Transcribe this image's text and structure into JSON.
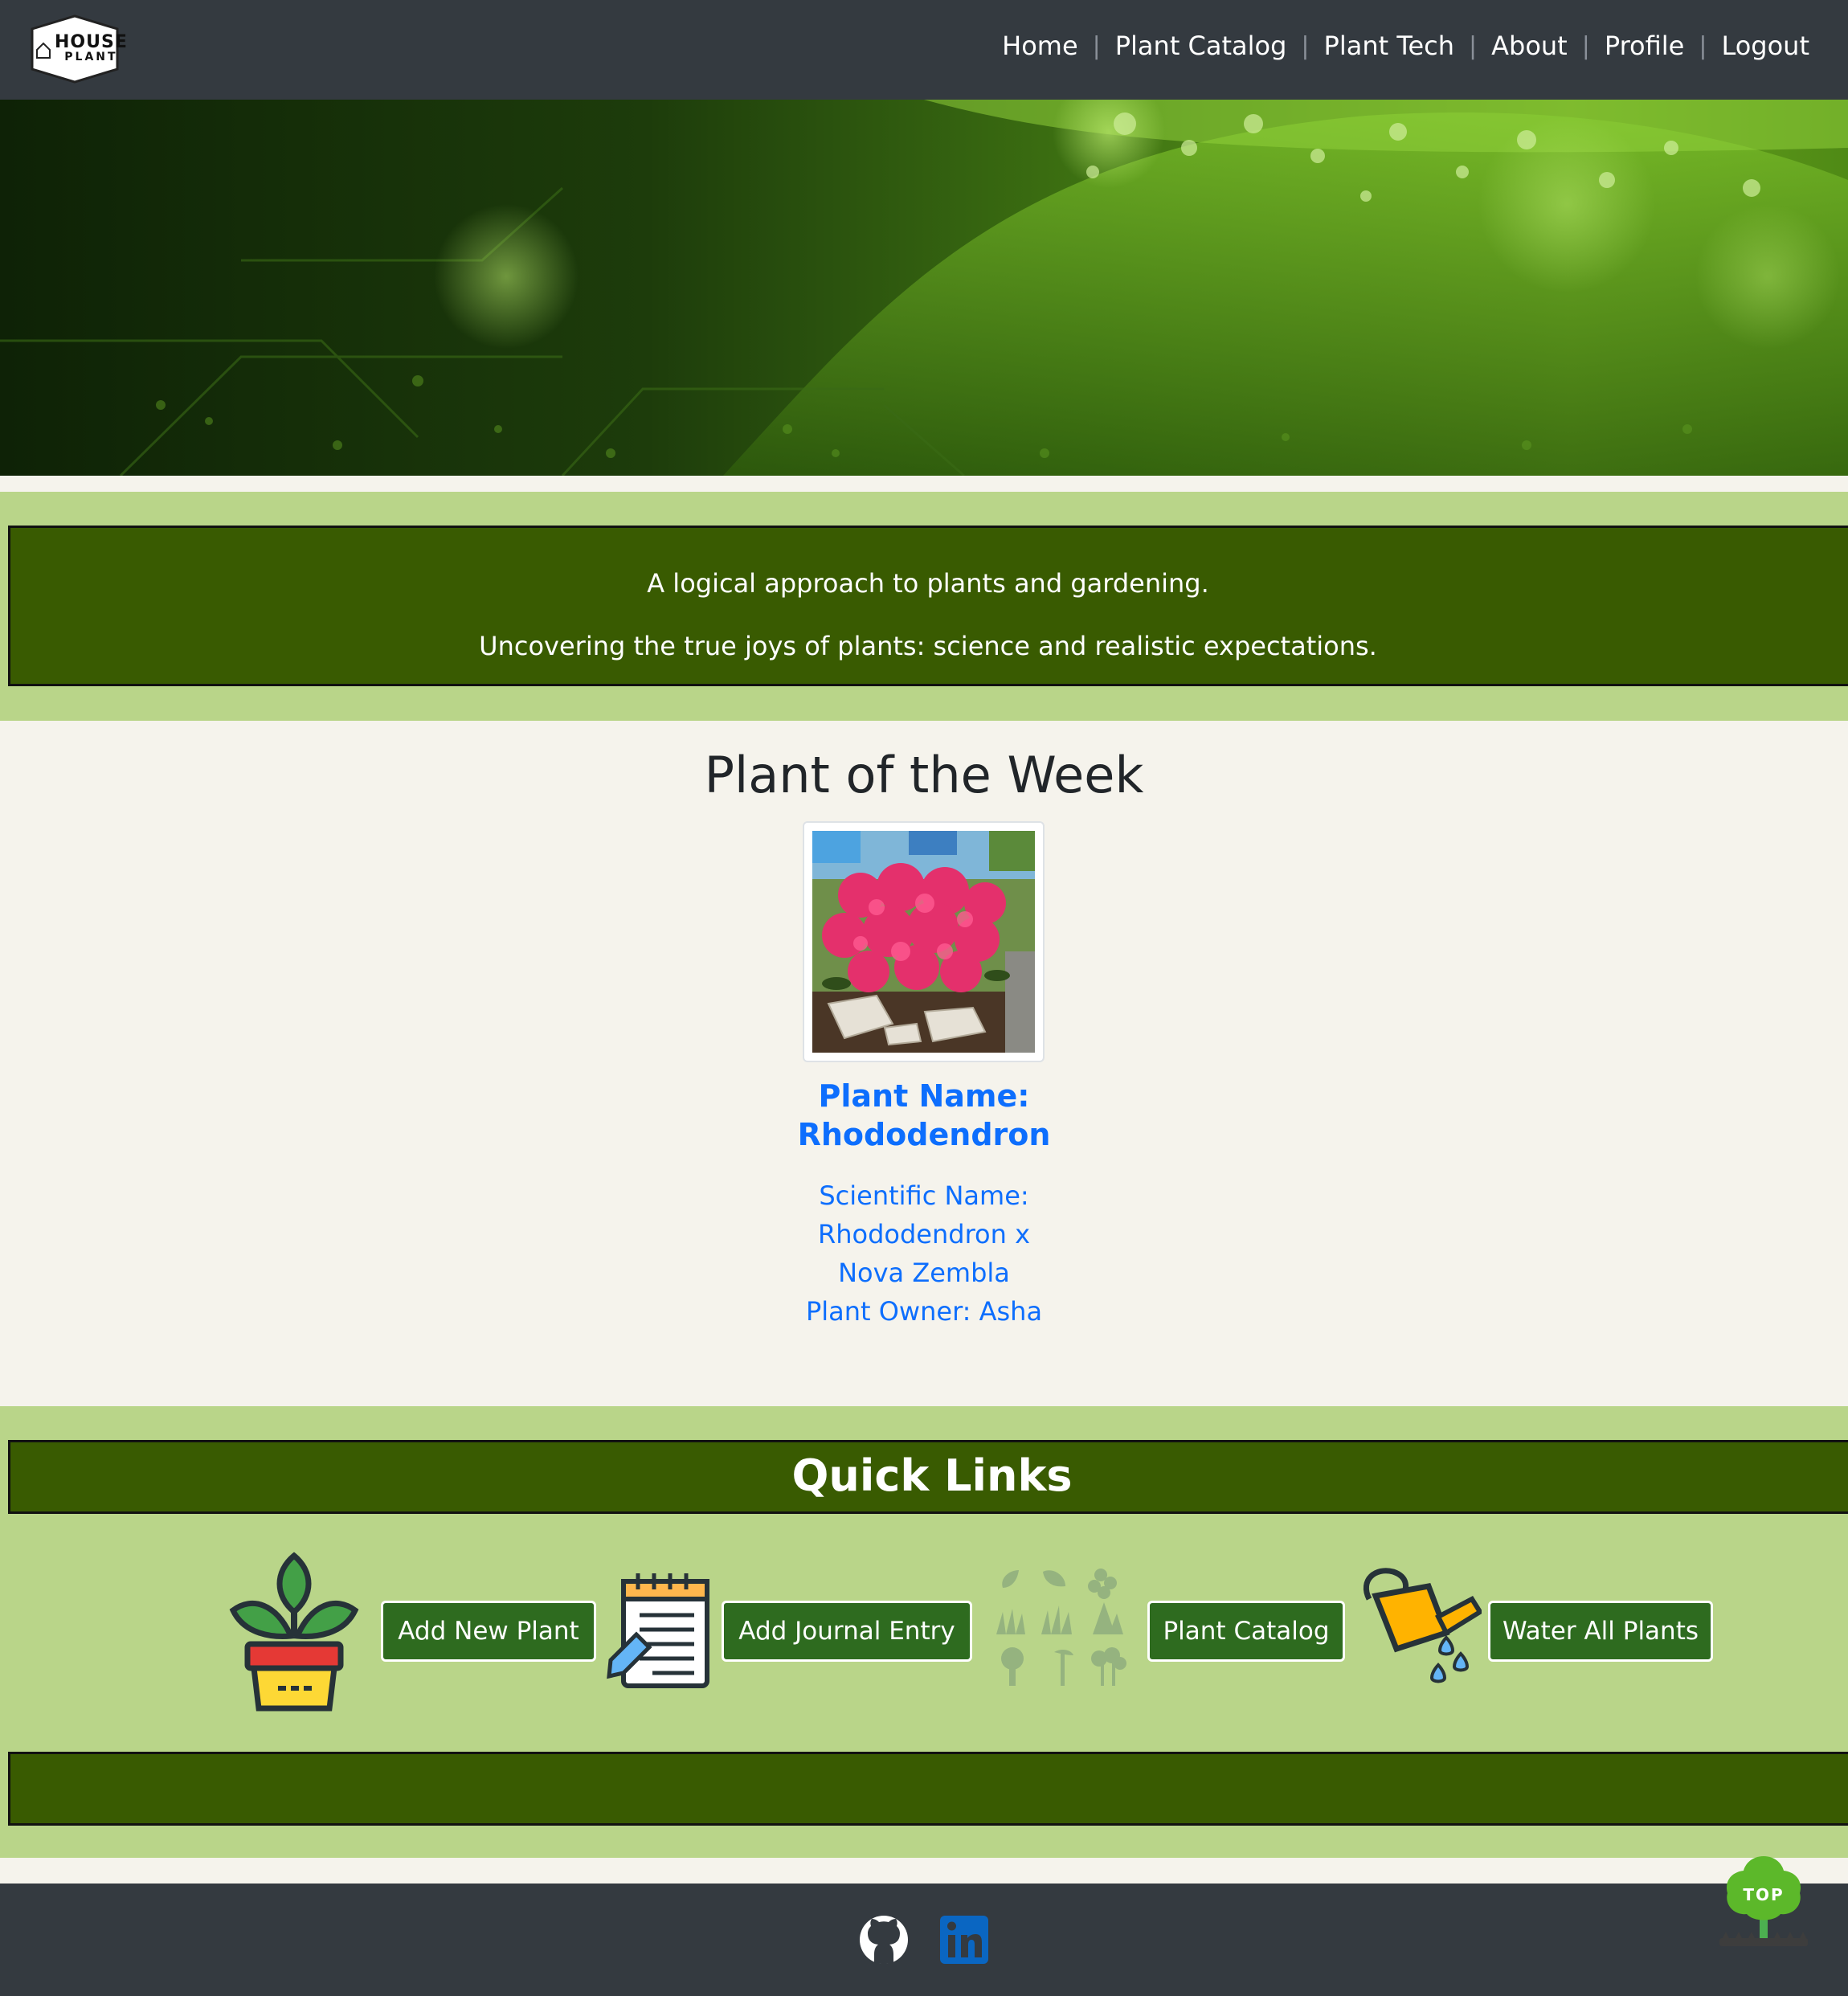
{
  "navbar": {
    "logo_text": "HOUSE",
    "logo_subtext": "PLANT",
    "links": [
      "Home",
      "Plant Catalog",
      "Plant Tech",
      "About",
      "Profile",
      "Logout"
    ],
    "separator": "|"
  },
  "tagline": {
    "line1": "A logical approach to plants and gardening.",
    "line2": "Uncovering the true joys of plants: science and realistic expectations."
  },
  "plant_of_week": {
    "title": "Plant of the Week",
    "name_label": "Plant Name:",
    "name_value": "Rhododendron",
    "scientific_label": "Scientific Name:",
    "scientific_value_line1": "Rhododendron x",
    "scientific_value_line2": "Nova Zembla",
    "owner": "Plant Owner: Asha"
  },
  "quick_links": {
    "title": "Quick Links",
    "buttons": [
      {
        "label": "Add New Plant",
        "icon": "potted-plant-icon"
      },
      {
        "label": "Add Journal Entry",
        "icon": "notepad-pencil-icon"
      },
      {
        "label": "Plant Catalog",
        "icon": "plant-varieties-icon"
      },
      {
        "label": "Water All Plants",
        "icon": "watering-can-icon"
      }
    ]
  },
  "footer": {
    "icons": [
      "github-icon",
      "linkedin-icon"
    ],
    "top_label": "TOP"
  },
  "colors": {
    "navbar_bg": "#343a40",
    "band_bg": "#b9d589",
    "band_box": "#395b01",
    "button_bg": "#2e6b1f",
    "link_blue": "#0d6efd",
    "page_bg": "#f5f3ec"
  }
}
